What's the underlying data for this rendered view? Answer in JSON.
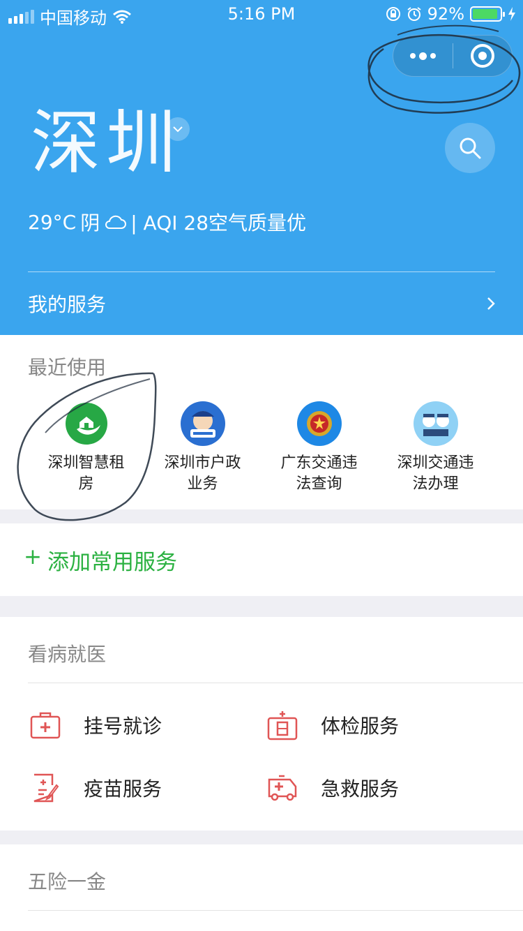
{
  "status": {
    "carrier": "中国移动",
    "time": "5:16 PM",
    "battery": "92%",
    "battery_level": 0.92
  },
  "header": {
    "city": "深圳",
    "weather": {
      "temp": "29°C",
      "condition": "阴",
      "aqi": "| AQI 28空气质量优"
    },
    "my_services": "我的服务"
  },
  "recent": {
    "title": "最近使用",
    "items": [
      {
        "label": "深圳智慧租房",
        "icon": "house-leaf-icon"
      },
      {
        "label": "深圳市户政业务",
        "icon": "police-mascot-icon"
      },
      {
        "label": "广东交通违法查询",
        "icon": "police-emblem-icon"
      },
      {
        "label": "深圳交通违法办理",
        "icon": "traffic-police-icon"
      }
    ]
  },
  "add_service": {
    "plus": "+",
    "label": "添加常用服务"
  },
  "medical": {
    "title": "看病就医",
    "items": [
      {
        "label": "挂号就诊",
        "icon": "medical-kit-icon"
      },
      {
        "label": "体检服务",
        "icon": "checkup-icon"
      },
      {
        "label": "疫苗服务",
        "icon": "vaccine-record-icon"
      },
      {
        "label": "急救服务",
        "icon": "ambulance-icon"
      }
    ]
  },
  "insurance": {
    "title": "五险一金"
  },
  "colors": {
    "header": "#3aa5ee",
    "accent_green": "#2bb141",
    "icon_red": "#e05555"
  }
}
